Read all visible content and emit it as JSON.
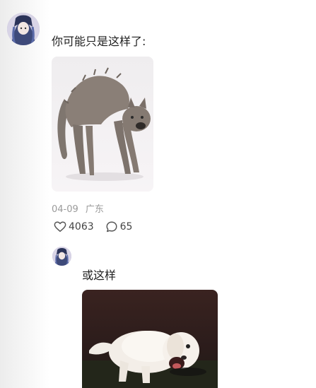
{
  "comment": {
    "text": "你可能只是这样了:",
    "date": "04-09",
    "location": "广东",
    "like_count": "4063",
    "reply_count": "65",
    "icons": {
      "like": "heart-outline-icon",
      "reply": "comment-bubble-icon"
    }
  },
  "reply": {
    "text": "或这样"
  }
}
